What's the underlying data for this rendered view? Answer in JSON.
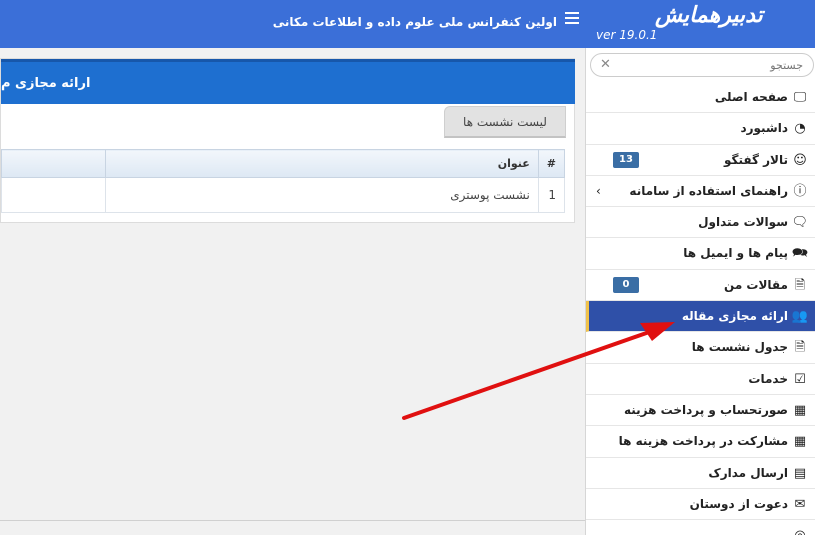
{
  "header": {
    "logo_text": "تدبیرهمایش",
    "version": "ver 19.0.1",
    "conference_title": "اولین کنفرانس ملی علوم داده و اطلاعات مکانی",
    "bg_color": "#3b6fd8"
  },
  "sidebar": {
    "search_placeholder": "جستجو",
    "active_color": "#2f50a8",
    "items": [
      {
        "label": "صفحه اصلی",
        "icon": "monitor-icon",
        "glyph": "🖵"
      },
      {
        "label": "داشبورد",
        "icon": "gauge-icon",
        "glyph": "◔"
      },
      {
        "label": "تالار گفتگو",
        "icon": "user-icon",
        "glyph": "☺",
        "badge": "13"
      },
      {
        "label": "راهنمای استفاده از سامانه",
        "icon": "info-icon",
        "glyph": "ⓘ",
        "chevron": "›"
      },
      {
        "label": "سوالات متداول",
        "icon": "chat-icon",
        "glyph": "🗨"
      },
      {
        "label": "پیام ها و ایمیل ها",
        "icon": "messages-icon",
        "glyph": "🗪"
      },
      {
        "label": "مقالات من",
        "icon": "document-icon",
        "glyph": "🗎",
        "badge": "0"
      },
      {
        "label": "ارائه مجازی مقاله",
        "icon": "group-icon",
        "glyph": "👥",
        "active": true
      },
      {
        "label": "جدول نشست ها",
        "icon": "document-icon",
        "glyph": "🗎"
      },
      {
        "label": "خدمات",
        "icon": "checklist-icon",
        "glyph": "☑"
      },
      {
        "label": "صورتحساب و پرداخت هزینه",
        "icon": "abacus-icon",
        "glyph": "▦"
      },
      {
        "label": "مشارکت در پرداخت هزینه ها",
        "icon": "abacus-icon",
        "glyph": "▦"
      },
      {
        "label": "ارسال مدارک",
        "icon": "upload-document-icon",
        "glyph": "▤"
      },
      {
        "label": "دعوت از دوستان",
        "icon": "invite-icon",
        "glyph": "✉"
      },
      {
        "label": "",
        "icon": "more-icon",
        "glyph": "◎"
      }
    ]
  },
  "main": {
    "panel_title": "ارائه مجازی م",
    "tab_label": "لیست نشست ها",
    "table": {
      "headers": [
        "#",
        "عنوان",
        ""
      ],
      "rows": [
        [
          "1",
          "نشست پوستری",
          ""
        ]
      ]
    }
  }
}
